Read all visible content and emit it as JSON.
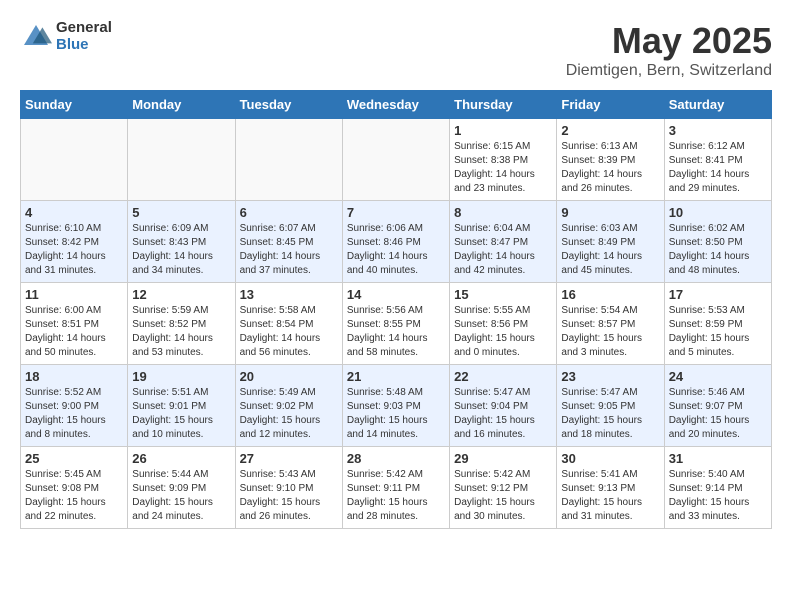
{
  "header": {
    "logo_general": "General",
    "logo_blue": "Blue",
    "month_title": "May 2025",
    "subtitle": "Diemtigen, Bern, Switzerland"
  },
  "days_of_week": [
    "Sunday",
    "Monday",
    "Tuesday",
    "Wednesday",
    "Thursday",
    "Friday",
    "Saturday"
  ],
  "weeks": [
    [
      {
        "day": "",
        "info": ""
      },
      {
        "day": "",
        "info": ""
      },
      {
        "day": "",
        "info": ""
      },
      {
        "day": "",
        "info": ""
      },
      {
        "day": "1",
        "info": "Sunrise: 6:15 AM\nSunset: 8:38 PM\nDaylight: 14 hours\nand 23 minutes."
      },
      {
        "day": "2",
        "info": "Sunrise: 6:13 AM\nSunset: 8:39 PM\nDaylight: 14 hours\nand 26 minutes."
      },
      {
        "day": "3",
        "info": "Sunrise: 6:12 AM\nSunset: 8:41 PM\nDaylight: 14 hours\nand 29 minutes."
      }
    ],
    [
      {
        "day": "4",
        "info": "Sunrise: 6:10 AM\nSunset: 8:42 PM\nDaylight: 14 hours\nand 31 minutes."
      },
      {
        "day": "5",
        "info": "Sunrise: 6:09 AM\nSunset: 8:43 PM\nDaylight: 14 hours\nand 34 minutes."
      },
      {
        "day": "6",
        "info": "Sunrise: 6:07 AM\nSunset: 8:45 PM\nDaylight: 14 hours\nand 37 minutes."
      },
      {
        "day": "7",
        "info": "Sunrise: 6:06 AM\nSunset: 8:46 PM\nDaylight: 14 hours\nand 40 minutes."
      },
      {
        "day": "8",
        "info": "Sunrise: 6:04 AM\nSunset: 8:47 PM\nDaylight: 14 hours\nand 42 minutes."
      },
      {
        "day": "9",
        "info": "Sunrise: 6:03 AM\nSunset: 8:49 PM\nDaylight: 14 hours\nand 45 minutes."
      },
      {
        "day": "10",
        "info": "Sunrise: 6:02 AM\nSunset: 8:50 PM\nDaylight: 14 hours\nand 48 minutes."
      }
    ],
    [
      {
        "day": "11",
        "info": "Sunrise: 6:00 AM\nSunset: 8:51 PM\nDaylight: 14 hours\nand 50 minutes."
      },
      {
        "day": "12",
        "info": "Sunrise: 5:59 AM\nSunset: 8:52 PM\nDaylight: 14 hours\nand 53 minutes."
      },
      {
        "day": "13",
        "info": "Sunrise: 5:58 AM\nSunset: 8:54 PM\nDaylight: 14 hours\nand 56 minutes."
      },
      {
        "day": "14",
        "info": "Sunrise: 5:56 AM\nSunset: 8:55 PM\nDaylight: 14 hours\nand 58 minutes."
      },
      {
        "day": "15",
        "info": "Sunrise: 5:55 AM\nSunset: 8:56 PM\nDaylight: 15 hours\nand 0 minutes."
      },
      {
        "day": "16",
        "info": "Sunrise: 5:54 AM\nSunset: 8:57 PM\nDaylight: 15 hours\nand 3 minutes."
      },
      {
        "day": "17",
        "info": "Sunrise: 5:53 AM\nSunset: 8:59 PM\nDaylight: 15 hours\nand 5 minutes."
      }
    ],
    [
      {
        "day": "18",
        "info": "Sunrise: 5:52 AM\nSunset: 9:00 PM\nDaylight: 15 hours\nand 8 minutes."
      },
      {
        "day": "19",
        "info": "Sunrise: 5:51 AM\nSunset: 9:01 PM\nDaylight: 15 hours\nand 10 minutes."
      },
      {
        "day": "20",
        "info": "Sunrise: 5:49 AM\nSunset: 9:02 PM\nDaylight: 15 hours\nand 12 minutes."
      },
      {
        "day": "21",
        "info": "Sunrise: 5:48 AM\nSunset: 9:03 PM\nDaylight: 15 hours\nand 14 minutes."
      },
      {
        "day": "22",
        "info": "Sunrise: 5:47 AM\nSunset: 9:04 PM\nDaylight: 15 hours\nand 16 minutes."
      },
      {
        "day": "23",
        "info": "Sunrise: 5:47 AM\nSunset: 9:05 PM\nDaylight: 15 hours\nand 18 minutes."
      },
      {
        "day": "24",
        "info": "Sunrise: 5:46 AM\nSunset: 9:07 PM\nDaylight: 15 hours\nand 20 minutes."
      }
    ],
    [
      {
        "day": "25",
        "info": "Sunrise: 5:45 AM\nSunset: 9:08 PM\nDaylight: 15 hours\nand 22 minutes."
      },
      {
        "day": "26",
        "info": "Sunrise: 5:44 AM\nSunset: 9:09 PM\nDaylight: 15 hours\nand 24 minutes."
      },
      {
        "day": "27",
        "info": "Sunrise: 5:43 AM\nSunset: 9:10 PM\nDaylight: 15 hours\nand 26 minutes."
      },
      {
        "day": "28",
        "info": "Sunrise: 5:42 AM\nSunset: 9:11 PM\nDaylight: 15 hours\nand 28 minutes."
      },
      {
        "day": "29",
        "info": "Sunrise: 5:42 AM\nSunset: 9:12 PM\nDaylight: 15 hours\nand 30 minutes."
      },
      {
        "day": "30",
        "info": "Sunrise: 5:41 AM\nSunset: 9:13 PM\nDaylight: 15 hours\nand 31 minutes."
      },
      {
        "day": "31",
        "info": "Sunrise: 5:40 AM\nSunset: 9:14 PM\nDaylight: 15 hours\nand 33 minutes."
      }
    ]
  ]
}
